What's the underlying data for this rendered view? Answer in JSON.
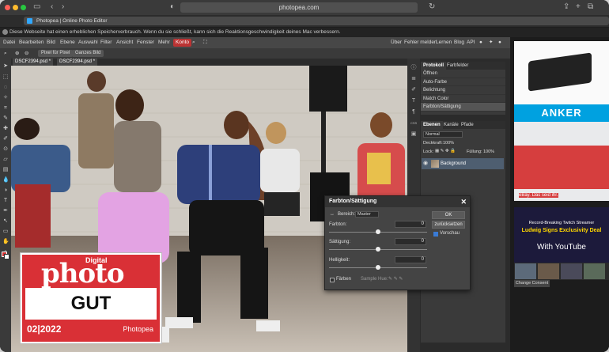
{
  "browser": {
    "url": "photopea.com",
    "tab_title": "Photopea | Online Photo Editor",
    "notice": "Diese Webseite hat einen erheblichen Speicherverbrauch. Wenn du sie schließt, kann sich die Reaktionsgeschwindigkeit deines Mac verbessern."
  },
  "menu": {
    "items": [
      "Datei",
      "Bearbeiten",
      "Bild",
      "Ebene",
      "Auswahl",
      "Filter",
      "Ansicht",
      "Fenster",
      "Mehr"
    ],
    "konto": "Konto",
    "right": [
      "Über",
      "Fehler melden",
      "Lernen",
      "Blog",
      "API"
    ]
  },
  "options": {
    "pixel": "Pixel für Pixel",
    "whole": "Ganzes Bild"
  },
  "documents": [
    "DSCF2394.psd *",
    "DSCF2394.psd *"
  ],
  "history": {
    "tabs": [
      "Protokoll",
      "Farbfelder"
    ],
    "items": [
      "Öffnen",
      "Auto-Farbe",
      "Belichtung",
      "Match Color",
      "Farbton/Sättigung"
    ]
  },
  "layers": {
    "tabs": [
      "Ebenen",
      "Kanäle",
      "Pfade"
    ],
    "blend": "Normal",
    "opacity_label": "Deckkraft:",
    "opacity": "100%",
    "lock_label": "Lock:",
    "fill_label": "Füllung:",
    "fill": "100%",
    "layer_name": "Background"
  },
  "dialog": {
    "title": "Farbton/Sättigung",
    "range_label": "Bereich:",
    "range_value": "Master",
    "hue_label": "Farbton:",
    "hue_value": "0",
    "sat_label": "Sättigung:",
    "sat_value": "0",
    "light_label": "Helligkeit:",
    "light_value": "0",
    "ok": "OK",
    "reset": "zurücksetzen",
    "preview": "Vorschau",
    "colorize": "Färben",
    "sample_hue": "Sample Hue:"
  },
  "ads": {
    "anker": "ANKER",
    "ebay": "eBay. Das seid ihr.",
    "twitch_l1": "Record-Breaking Twitch Streamer",
    "twitch_l2": "Ludwig Signs Exclusivity Deal",
    "twitch_l3": "With YouTube",
    "consent": "Change Consent"
  },
  "badge": {
    "small": "Digital",
    "big": "photo",
    "rating": "GUT",
    "date": "02|2022",
    "brand": "Photopea"
  },
  "colors": {
    "konto": "#b33333",
    "badge_red": "#d93036",
    "anker_blue": "#00a1e0",
    "layer_sel": "#4e5e70"
  }
}
